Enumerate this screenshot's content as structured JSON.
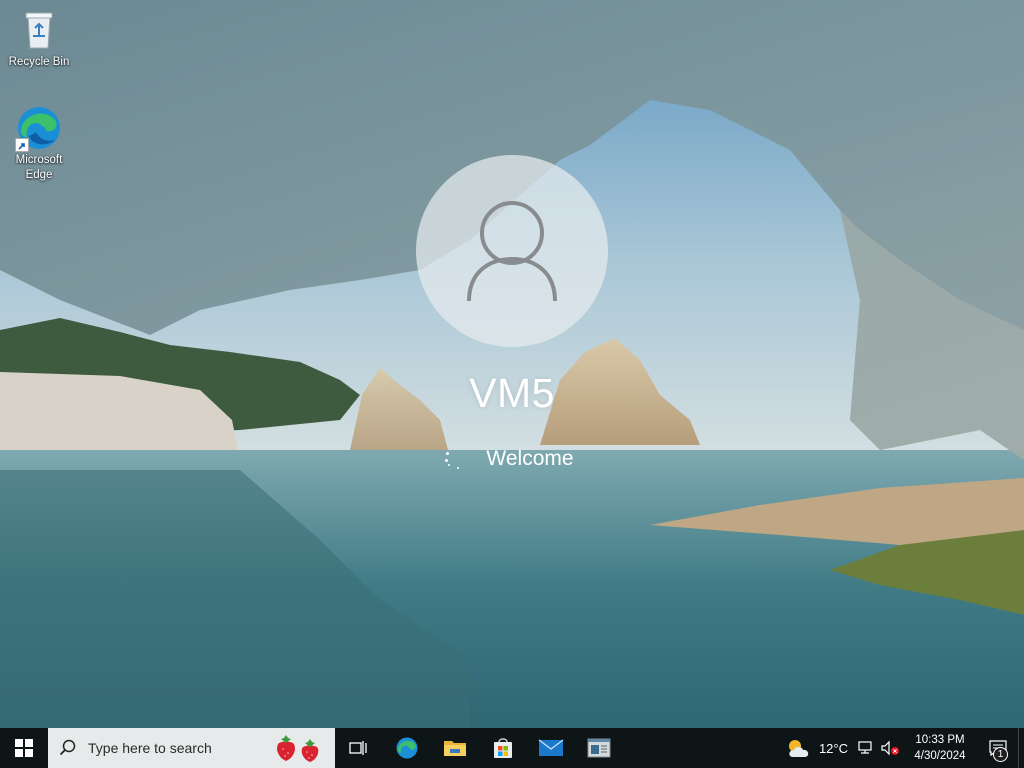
{
  "desktop": {
    "icons": [
      {
        "label": "Recycle Bin",
        "icon": "recycle-bin-icon"
      },
      {
        "label": "Microsoft Edge",
        "icon": "edge-icon"
      }
    ]
  },
  "welcome": {
    "user_name": "VM5",
    "status_text": "Welcome",
    "avatar_icon": "user-avatar-icon"
  },
  "taskbar": {
    "start_icon": "windows-start-icon",
    "search_placeholder": "Type here to search",
    "search_icon": "search-icon",
    "pinned": [
      {
        "name": "task-view",
        "icon": "task-view-icon"
      },
      {
        "name": "edge",
        "icon": "edge-icon"
      },
      {
        "name": "file-explorer",
        "icon": "folder-icon"
      },
      {
        "name": "microsoft-store",
        "icon": "store-icon"
      },
      {
        "name": "mail",
        "icon": "mail-icon"
      },
      {
        "name": "app",
        "icon": "window-app-icon"
      }
    ],
    "tray": {
      "weather_icon": "partly-cloudy-icon",
      "temperature": "12°C",
      "network_icon": "network-icon",
      "volume_icon": "volume-muted-icon",
      "time": "10:33 PM",
      "date": "4/30/2024",
      "notification_icon": "action-center-icon",
      "notification_count": "1"
    }
  },
  "colors": {
    "taskbar_bg": "#0e1516",
    "search_bg": "#e7eaea",
    "text_light": "#ffffff",
    "edge_blue": "#1b8fd6",
    "edge_green": "#3cc06a"
  }
}
